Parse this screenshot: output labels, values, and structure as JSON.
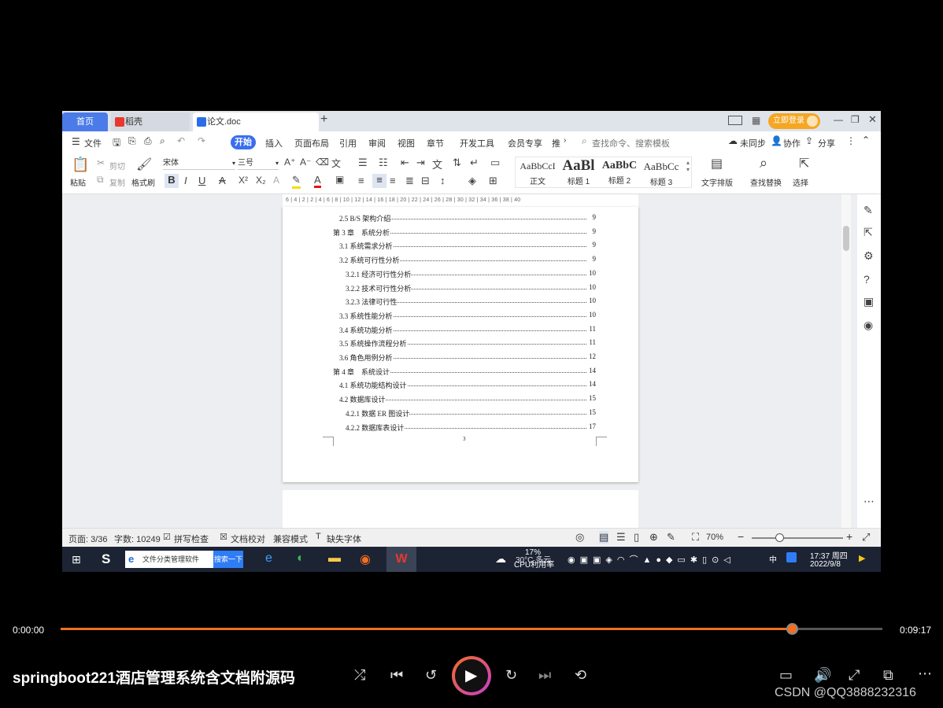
{
  "tabs": {
    "home": "首页",
    "daoke": "稻壳",
    "doc": "论文.doc",
    "add": "+",
    "login": "立即登录"
  },
  "menu": {
    "file": "文件",
    "items": [
      "开始",
      "插入",
      "页面布局",
      "引用",
      "审阅",
      "视图",
      "章节",
      "开发工具",
      "会员专享",
      "推"
    ],
    "search": "查找命令、搜索模板",
    "sync": "未同步",
    "collab": "协作",
    "share": "分享"
  },
  "ribbon": {
    "paste": "粘贴",
    "cut": "剪切",
    "copy": "复制",
    "format_painter": "格式刷",
    "font": "宋体",
    "size": "三号",
    "styles": [
      {
        "preview": "AaBbCcI",
        "name": "正文"
      },
      {
        "preview": "AaBl",
        "name": "标题 1"
      },
      {
        "preview": "AaBbC",
        "name": "标题 2"
      },
      {
        "preview": "AaBbCc",
        "name": "标题 3"
      }
    ],
    "text_layout": "文字排版",
    "find_replace": "查找替换",
    "select": "选择"
  },
  "ruler": "6 | 4 | 2 | 2 | 4 | 6 | 8 | 10 | 12 | 14 | 16 | 18 | 20 | 22 | 24 | 26 | 28 | 30 | 32 | 34 | 36 | 38 | 40",
  "toc": [
    {
      "text": "2.5 B/S 架构介绍",
      "page": "9",
      "level": 2
    },
    {
      "text": "第 3 章　系统分析",
      "page": "9",
      "level": 1
    },
    {
      "text": "3.1 系统需求分析",
      "page": "9",
      "level": 2
    },
    {
      "text": "3.2 系统可行性分析",
      "page": "9",
      "level": 2
    },
    {
      "text": "3.2.1 经济可行性分析",
      "page": "10",
      "level": 3
    },
    {
      "text": "3.2.2  技术可行性分析",
      "page": "10",
      "level": 3
    },
    {
      "text": "3.2.3  法律可行性",
      "page": "10",
      "level": 3
    },
    {
      "text": "3.3 系统性能分析",
      "page": "10",
      "level": 2
    },
    {
      "text": "3.4 系统功能分析",
      "page": "11",
      "level": 2
    },
    {
      "text": "3.5 系统操作流程分析",
      "page": "11",
      "level": 2
    },
    {
      "text": "3.6 角色用例分析",
      "page": "12",
      "level": 2
    },
    {
      "text": "第 4 章　系统设计",
      "page": "14",
      "level": 1
    },
    {
      "text": "4.1 系统功能结构设计",
      "page": "14",
      "level": 2
    },
    {
      "text": "4.2 数据库设计",
      "page": "15",
      "level": 2
    },
    {
      "text": "4.2.1 数据 ER 图设计",
      "page": "15",
      "level": 3
    },
    {
      "text": "4.2.2 数据库表设计",
      "page": "17",
      "level": 3
    }
  ],
  "page_footer_num": "3",
  "status": {
    "page": "页面: 3/36",
    "words": "字数: 10249",
    "spell": "拼写检查",
    "proof": "文档校对",
    "compat": "兼容模式",
    "missing_font": "缺失字体",
    "zoom": "70%"
  },
  "taskbar": {
    "search_text": "文件分类管理软件",
    "search_btn": "搜索一下",
    "cpu_pct": "17%",
    "cpu_label": "CPU利用率",
    "weather": "30°C 多云",
    "ime": "中",
    "time": "17:37 周四",
    "date": "2022/9/8"
  },
  "player": {
    "current": "0:00:00",
    "total": "0:09:17",
    "progress": 0.89,
    "title": "springboot221酒店管理系统含文档附源码",
    "watermark": "CSDN @QQ3888232316"
  },
  "colors": {
    "accent": "#3a6ef0",
    "progress": "#f36f21",
    "login": "#f5a623"
  }
}
